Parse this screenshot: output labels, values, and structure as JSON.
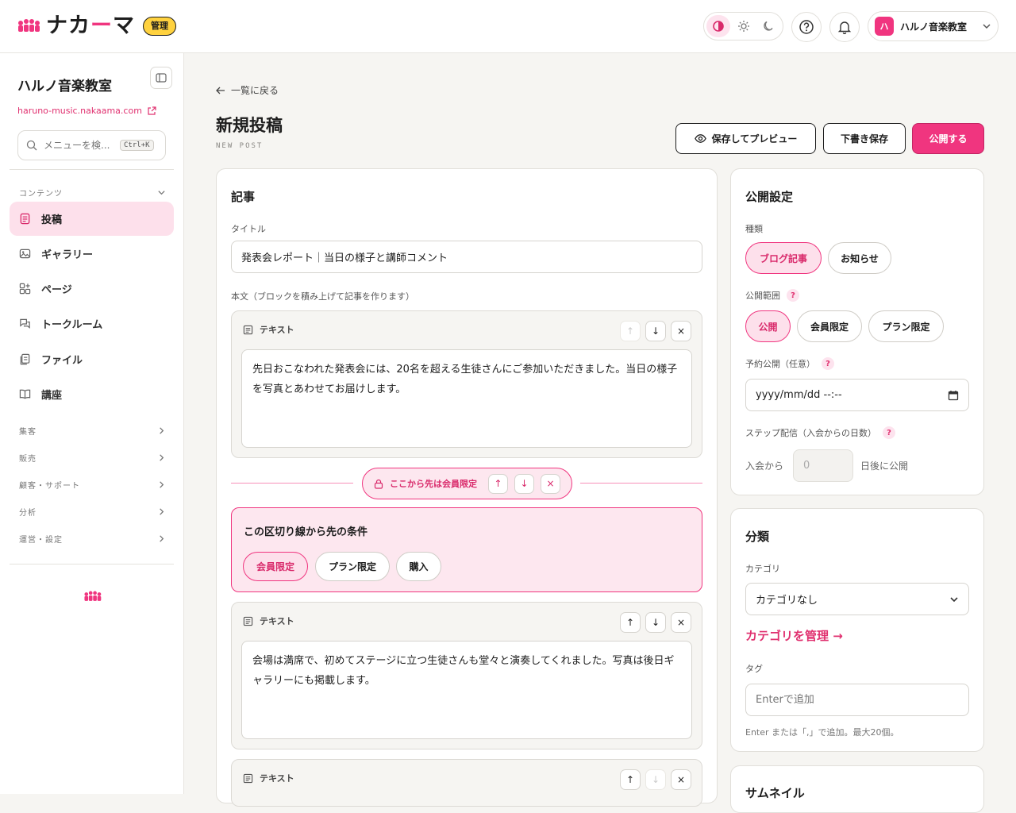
{
  "brand": {
    "name_prefix": "ナカ",
    "name_dash": "ー",
    "name_suffix": "マ",
    "badge": "管理",
    "accent": "#f0357f"
  },
  "account": {
    "avatar": "ハ",
    "name": "ハルノ音楽教室"
  },
  "sidebar": {
    "title": "ハルノ音楽教室",
    "url": "haruno-music.nakaama.com",
    "search_placeholder": "メニューを検...",
    "search_shortcut": "Ctrl+K",
    "content_header": "コンテンツ",
    "items": [
      {
        "label": "投稿",
        "icon": "post-icon"
      },
      {
        "label": "ギャラリー",
        "icon": "image-icon"
      },
      {
        "label": "ページ",
        "icon": "page-icon"
      },
      {
        "label": "トークルーム",
        "icon": "chat-icon"
      },
      {
        "label": "ファイル",
        "icon": "file-icon"
      },
      {
        "label": "講座",
        "icon": "book-icon"
      }
    ],
    "groups": [
      "集客",
      "販売",
      "顧客・サポート",
      "分析",
      "運営・設定"
    ]
  },
  "main": {
    "back_label": "一覧に戻る",
    "title": "新規投稿",
    "subtitle": "NEW POST",
    "preview_btn": "保存してプレビュー",
    "draft_btn": "下書き保存",
    "publish_btn": "公開する"
  },
  "article": {
    "card_title": "記事",
    "title_label": "タイトル",
    "title_value": "発表会レポート｜当日の様子と講師コメント",
    "body_label": "本文（ブロックを積み上げて記事を作ります）",
    "block1": {
      "type": "テキスト",
      "text": "先日おこなわれた発表会には、20名を超える生徒さんにご参加いただきました。当日の様子を写真とあわせてお届けします。"
    },
    "member_divider": "ここから先は会員限定",
    "condition_title": "この区切り線から先の条件",
    "conditions": [
      "会員限定",
      "プラン限定",
      "購入"
    ],
    "block2": {
      "type": "テキスト",
      "text": "会場は満席で、初めてステージに立つ生徒さんも堂々と演奏してくれました。写真は後日ギャラリーにも掲載します。"
    },
    "block3": {
      "type": "テキスト"
    }
  },
  "publish": {
    "card_title": "公開設定",
    "kind_label": "種類",
    "kinds": [
      "ブログ記事",
      "お知らせ"
    ],
    "scope_label": "公開範囲",
    "scopes": [
      "公開",
      "会員限定",
      "プラン限定"
    ],
    "schedule_label": "予約公開（任意）",
    "schedule_value": "yyyy/mm/dd --:--",
    "step_label": "ステップ配信（入会からの日数）",
    "step_prefix": "入会から",
    "step_placeholder": "0",
    "step_suffix": "日後に公開"
  },
  "classify": {
    "card_title": "分類",
    "category_label": "カテゴリ",
    "category_value": "カテゴリなし",
    "manage_link": "カテゴリを管理 →",
    "tag_label": "タグ",
    "tag_placeholder": "Enterで追加",
    "tag_hint": "Enter または「,」で追加。最大20個。"
  },
  "thumbnail": {
    "card_title": "サムネイル"
  }
}
